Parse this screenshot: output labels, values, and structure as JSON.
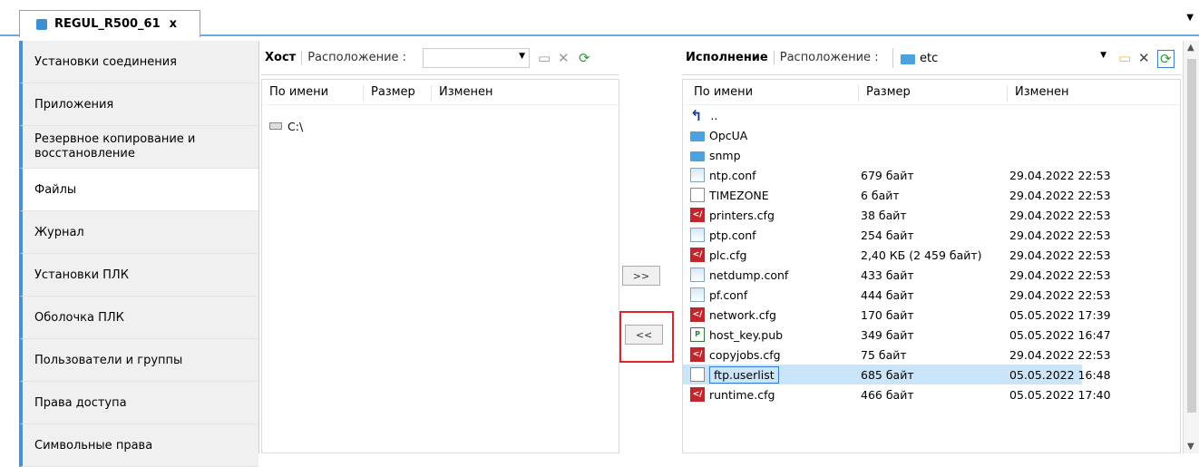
{
  "tab": {
    "title": "REGUL_R500_61",
    "close": "x"
  },
  "sidebar": {
    "items": [
      {
        "label": "Установки соединения"
      },
      {
        "label": "Приложения"
      },
      {
        "label": "Резервное копирование и восстановление"
      },
      {
        "label": "Файлы",
        "active": true
      },
      {
        "label": "Журнал"
      },
      {
        "label": "Установки ПЛК"
      },
      {
        "label": "Оболочка ПЛК"
      },
      {
        "label": "Пользователи и группы"
      },
      {
        "label": "Права доступа"
      },
      {
        "label": "Символьные права"
      }
    ]
  },
  "host": {
    "label": "Хост",
    "location_label": "Расположение :",
    "columns": [
      "По имени",
      "Размер",
      "Изменен"
    ],
    "rows": [
      {
        "name": "C:\\"
      }
    ]
  },
  "transfer": {
    "to_device": ">>",
    "to_host": "<<"
  },
  "exec": {
    "label": "Исполнение",
    "location_label": "Расположение :",
    "location_value": "etc",
    "columns": [
      "По имени",
      "Размер",
      "Изменен"
    ],
    "up_label": "..",
    "rows": [
      {
        "name": "OpcUA",
        "size": "",
        "date": "",
        "icon": "folder-icon"
      },
      {
        "name": "snmp",
        "size": "",
        "date": "",
        "icon": "folder-icon"
      },
      {
        "name": "ntp.conf",
        "size": "679 байт",
        "date": "29.04.2022 22:53",
        "icon": "conf-file-icon"
      },
      {
        "name": "TIMEZONE",
        "size": "6 байт",
        "date": "29.04.2022 22:53",
        "icon": "file-icon"
      },
      {
        "name": "printers.cfg",
        "size": "38 байт",
        "date": "29.04.2022 22:53",
        "icon": "cfg-file-icon"
      },
      {
        "name": "ptp.conf",
        "size": "254 байт",
        "date": "29.04.2022 22:53",
        "icon": "conf-file-icon"
      },
      {
        "name": "plc.cfg",
        "size": "2,40 КБ (2 459 байт)",
        "date": "29.04.2022 22:53",
        "icon": "cfg-file-icon"
      },
      {
        "name": "netdump.conf",
        "size": "433 байт",
        "date": "29.04.2022 22:53",
        "icon": "conf-file-icon"
      },
      {
        "name": "pf.conf",
        "size": "444 байт",
        "date": "29.04.2022 22:53",
        "icon": "conf-file-icon"
      },
      {
        "name": "network.cfg",
        "size": "170 байт",
        "date": "05.05.2022 17:39",
        "icon": "cfg-file-icon"
      },
      {
        "name": "host_key.pub",
        "size": "349 байт",
        "date": "05.05.2022 16:47",
        "icon": "pub-file-icon"
      },
      {
        "name": "copyjobs.cfg",
        "size": "75 байт",
        "date": "29.04.2022 22:53",
        "icon": "cfg-file-icon"
      },
      {
        "name": "ftp.userlist",
        "size": "685 байт",
        "date": "05.05.2022 16:48",
        "icon": "file-icon",
        "selected": true
      },
      {
        "name": "runtime.cfg",
        "size": "466 байт",
        "date": "05.05.2022 17:40",
        "icon": "cfg-file-icon"
      }
    ]
  }
}
